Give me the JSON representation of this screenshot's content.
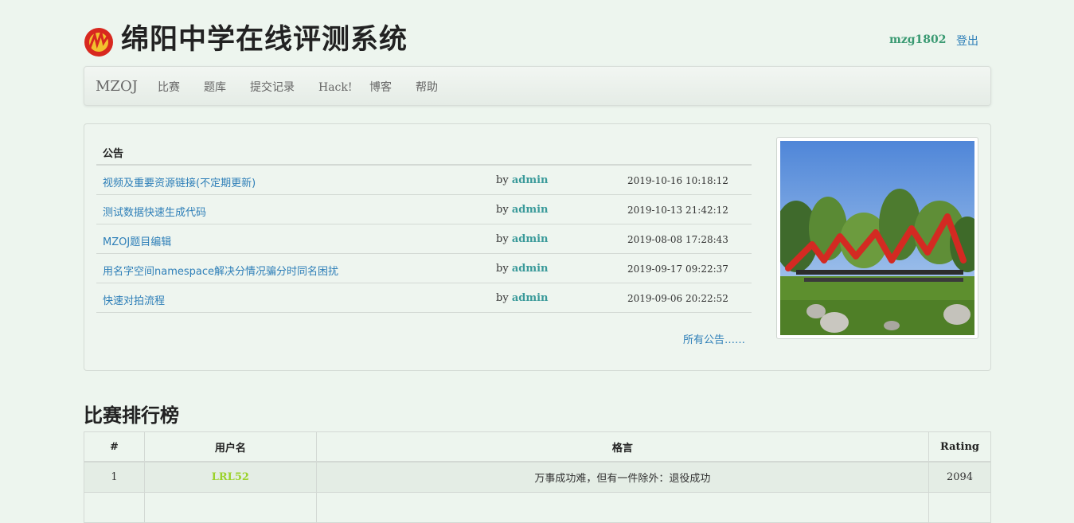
{
  "site": {
    "title": "绵阳中学在线评测系统",
    "logo_icon": "school-logo-icon",
    "user": "mzg1802",
    "logout": "登出"
  },
  "nav": {
    "brand": "MZOJ",
    "items": [
      "比赛",
      "题库",
      "提交记录",
      "Hack!",
      "博客",
      "帮助"
    ]
  },
  "announcements": {
    "header": "公告",
    "by_label": "by",
    "rows": [
      {
        "title": "视频及重要资源链接(不定期更新)",
        "author": "admin",
        "date": "2019-10-16 10:18:12"
      },
      {
        "title": "测试数据快速生成代码",
        "author": "admin",
        "date": "2019-10-13 21:42:12"
      },
      {
        "title": "MZOJ题目编辑",
        "author": "admin",
        "date": "2019-08-08 17:28:43"
      },
      {
        "title": "用名字空间namespace解决分情况骗分时同名困扰",
        "author": "admin",
        "date": "2019-09-17 09:22:37"
      },
      {
        "title": "快速对拍流程",
        "author": "admin",
        "date": "2019-09-06 20:22:52"
      }
    ],
    "all_link": "所有公告……"
  },
  "ranking": {
    "title": "比赛排行榜",
    "columns": [
      "#",
      "用户名",
      "格言",
      "Rating"
    ],
    "rows": [
      {
        "rank": "1",
        "user": "LRL52",
        "motto": "万事成功难，但有一件除外：退役成功",
        "rating": "2094"
      }
    ]
  },
  "colors": {
    "background": "#edf5ee",
    "link": "#2e7fb8",
    "author": "#3a9a9a",
    "user_green": "#9bd22a"
  }
}
